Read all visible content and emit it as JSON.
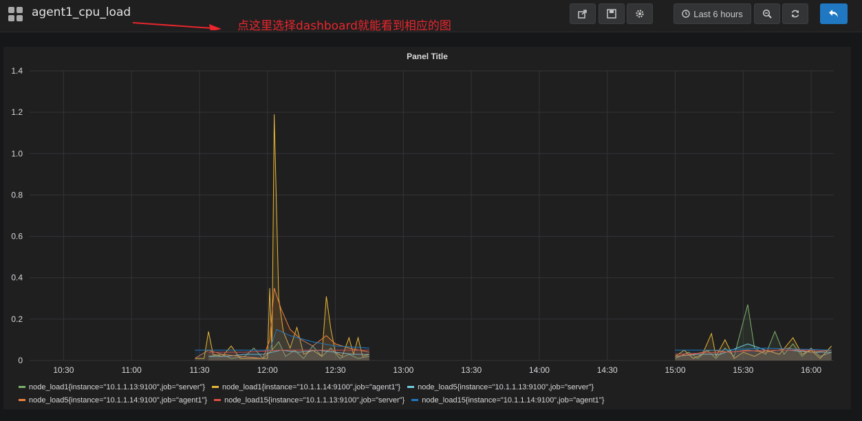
{
  "navbar": {
    "dashboard_title": "agent1_cpu_load",
    "annotation": "点这里选择dashboard就能看到相应的图",
    "time_range_label": "Last 6 hours",
    "buttons": [
      "share-icon",
      "save-icon",
      "gear-icon",
      "clock-icon",
      "zoom-out-icon",
      "refresh-icon",
      "back-icon"
    ]
  },
  "colors": {
    "grid": "#343437",
    "accent": "#1f78c1"
  },
  "chart_data": {
    "type": "line",
    "title": "Panel Title",
    "x_ticks": [
      "10:30",
      "11:00",
      "11:30",
      "12:00",
      "12:30",
      "13:00",
      "13:30",
      "14:00",
      "14:30",
      "15:00",
      "15:30",
      "16:00"
    ],
    "y_ticks": [
      "0",
      "0.2",
      "0.4",
      "0.6",
      "0.8",
      "1.0",
      "1.2",
      "1.4"
    ],
    "ylim": [
      0,
      1.4
    ],
    "xlim": [
      "10:15",
      "16:10"
    ],
    "grid": true,
    "legend_position": "bottom",
    "series": [
      {
        "name": "node_load1{instance=\"10.1.1.13:9100\",job=\"server\"}",
        "color": "#7eb26d",
        "points": [
          [
            "11:34",
            0.02
          ],
          [
            "11:40",
            0.03
          ],
          [
            "11:44",
            0.01
          ],
          [
            "11:50",
            0.02
          ],
          [
            "11:54",
            0.06
          ],
          [
            "11:58",
            0.01
          ],
          [
            "12:02",
            0.05
          ],
          [
            "12:05",
            0.09
          ],
          [
            "12:08",
            0.02
          ],
          [
            "12:12",
            0.05
          ],
          [
            "12:16",
            0.01
          ],
          [
            "12:20",
            0.07
          ],
          [
            "12:24",
            0.02
          ],
          [
            "12:28",
            0.06
          ],
          [
            "12:32",
            0.01
          ],
          [
            "12:36",
            0.03
          ],
          [
            "12:40",
            0.01
          ],
          [
            "12:45",
            0.02
          ],
          [
            "15:00",
            0.01
          ],
          [
            "15:06",
            0.04
          ],
          [
            "15:10",
            0.01
          ],
          [
            "15:14",
            0.05
          ],
          [
            "15:18",
            0.01
          ],
          [
            "15:22",
            0.06
          ],
          [
            "15:26",
            0.02
          ],
          [
            "15:32",
            0.27
          ],
          [
            "15:35",
            0.06
          ],
          [
            "15:40",
            0.03
          ],
          [
            "15:44",
            0.14
          ],
          [
            "15:48",
            0.03
          ],
          [
            "15:52",
            0.08
          ],
          [
            "15:56",
            0.02
          ],
          [
            "16:00",
            0.06
          ],
          [
            "16:04",
            0.02
          ],
          [
            "16:09",
            0.04
          ]
        ]
      },
      {
        "name": "node_load1{instance=\"10.1.1.14:9100\",job=\"agent1\"}",
        "color": "#eab839",
        "points": [
          [
            "11:28",
            0.01
          ],
          [
            "11:32",
            0.01
          ],
          [
            "11:34",
            0.14
          ],
          [
            "11:36",
            0.03
          ],
          [
            "11:40",
            0.02
          ],
          [
            "11:44",
            0.07
          ],
          [
            "11:48",
            0.01
          ],
          [
            "11:55",
            0.01
          ],
          [
            "12:00",
            0.01
          ],
          [
            "12:01",
            0.35
          ],
          [
            "12:02",
            0.05
          ],
          [
            "12:03",
            1.19
          ],
          [
            "12:05",
            0.3
          ],
          [
            "12:07",
            0.14
          ],
          [
            "12:10",
            0.06
          ],
          [
            "12:13",
            0.16
          ],
          [
            "12:16",
            0.03
          ],
          [
            "12:20",
            0.05
          ],
          [
            "12:24",
            0.02
          ],
          [
            "12:26",
            0.31
          ],
          [
            "12:28",
            0.15
          ],
          [
            "12:30",
            0.04
          ],
          [
            "12:33",
            0.02
          ],
          [
            "12:36",
            0.11
          ],
          [
            "12:38",
            0.03
          ],
          [
            "12:40",
            0.11
          ],
          [
            "12:42",
            0.02
          ],
          [
            "12:45",
            0.03
          ],
          [
            "15:00",
            0.02
          ],
          [
            "15:04",
            0.05
          ],
          [
            "15:08",
            0.01
          ],
          [
            "15:12",
            0.03
          ],
          [
            "15:16",
            0.13
          ],
          [
            "15:18",
            0.02
          ],
          [
            "15:22",
            0.1
          ],
          [
            "15:26",
            0.01
          ],
          [
            "15:30",
            0.04
          ],
          [
            "15:35",
            0.02
          ],
          [
            "15:40",
            0.05
          ],
          [
            "15:46",
            0.03
          ],
          [
            "15:52",
            0.11
          ],
          [
            "15:56",
            0.03
          ],
          [
            "16:00",
            0.05
          ],
          [
            "16:04",
            0.01
          ],
          [
            "16:09",
            0.07
          ]
        ]
      },
      {
        "name": "node_load5{instance=\"10.1.1.13:9100\",job=\"server\"}",
        "color": "#6ed0e0",
        "points": [
          [
            "11:34",
            0.02
          ],
          [
            "11:42",
            0.02
          ],
          [
            "11:50",
            0.03
          ],
          [
            "11:58",
            0.03
          ],
          [
            "12:06",
            0.05
          ],
          [
            "12:14",
            0.04
          ],
          [
            "12:22",
            0.05
          ],
          [
            "12:30",
            0.04
          ],
          [
            "12:38",
            0.03
          ],
          [
            "12:45",
            0.03
          ],
          [
            "15:00",
            0.02
          ],
          [
            "15:10",
            0.03
          ],
          [
            "15:20",
            0.03
          ],
          [
            "15:32",
            0.08
          ],
          [
            "15:40",
            0.05
          ],
          [
            "15:50",
            0.05
          ],
          [
            "16:00",
            0.04
          ],
          [
            "16:09",
            0.04
          ]
        ]
      },
      {
        "name": "node_load5{instance=\"10.1.1.14:9100\",job=\"agent1\"}",
        "color": "#ef843c",
        "points": [
          [
            "11:28",
            0.01
          ],
          [
            "11:34",
            0.05
          ],
          [
            "11:40",
            0.03
          ],
          [
            "11:48",
            0.02
          ],
          [
            "11:58",
            0.01
          ],
          [
            "12:01",
            0.1
          ],
          [
            "12:03",
            0.35
          ],
          [
            "12:06",
            0.25
          ],
          [
            "12:10",
            0.15
          ],
          [
            "12:15",
            0.1
          ],
          [
            "12:20",
            0.07
          ],
          [
            "12:26",
            0.12
          ],
          [
            "12:30",
            0.08
          ],
          [
            "12:36",
            0.06
          ],
          [
            "12:45",
            0.04
          ],
          [
            "15:00",
            0.02
          ],
          [
            "15:08",
            0.03
          ],
          [
            "15:16",
            0.05
          ],
          [
            "15:24",
            0.04
          ],
          [
            "15:32",
            0.05
          ],
          [
            "15:40",
            0.04
          ],
          [
            "15:50",
            0.06
          ],
          [
            "16:00",
            0.04
          ],
          [
            "16:09",
            0.05
          ]
        ]
      },
      {
        "name": "node_load15{instance=\"10.1.1.13:9100\",job=\"server\"}",
        "color": "#e24d42",
        "points": [
          [
            "11:34",
            0.04
          ],
          [
            "11:50",
            0.04
          ],
          [
            "12:05",
            0.05
          ],
          [
            "12:20",
            0.05
          ],
          [
            "12:45",
            0.05
          ],
          [
            "15:00",
            0.03
          ],
          [
            "15:20",
            0.04
          ],
          [
            "15:40",
            0.05
          ],
          [
            "16:09",
            0.05
          ]
        ]
      },
      {
        "name": "node_load15{instance=\"10.1.1.14:9100\",job=\"agent1\"}",
        "color": "#1f78c1",
        "points": [
          [
            "11:28",
            0.05
          ],
          [
            "11:34",
            0.05
          ],
          [
            "11:50",
            0.05
          ],
          [
            "12:01",
            0.05
          ],
          [
            "12:04",
            0.15
          ],
          [
            "12:10",
            0.12
          ],
          [
            "12:20",
            0.09
          ],
          [
            "12:30",
            0.07
          ],
          [
            "12:45",
            0.06
          ],
          [
            "15:00",
            0.05
          ],
          [
            "15:20",
            0.05
          ],
          [
            "15:40",
            0.06
          ],
          [
            "16:09",
            0.05
          ]
        ]
      }
    ]
  }
}
